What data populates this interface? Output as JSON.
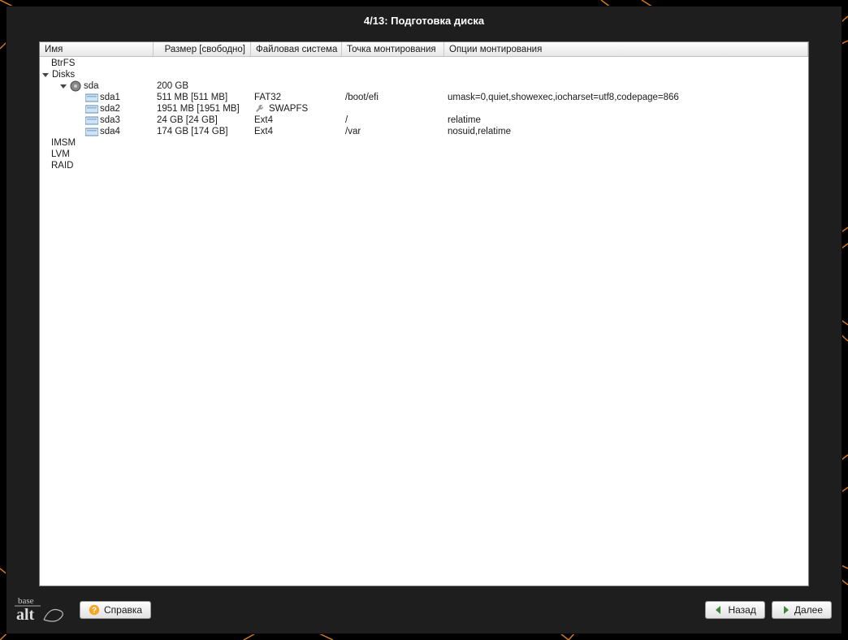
{
  "title": "4/13: Подготовка диска",
  "columns": {
    "name": "Имя",
    "size": "Размер [свободно]",
    "fs": "Файловая система",
    "mount": "Точка монтирования",
    "opts": "Опции монтирования"
  },
  "tree": {
    "btrfs": "BtrFS",
    "disks": "Disks",
    "sda": {
      "name": "sda",
      "size": "200 GB"
    },
    "sda1": {
      "name": "sda1",
      "size": "511 MB [511 MB]",
      "fs": "FAT32",
      "mount": "/boot/efi",
      "opts": "umask=0,quiet,showexec,iocharset=utf8,codepage=866"
    },
    "sda2": {
      "name": "sda2",
      "size": "1951 MB [1951 MB]",
      "fs": "SWAPFS",
      "mount": "",
      "opts": ""
    },
    "sda3": {
      "name": "sda3",
      "size": "24 GB [24 GB]",
      "fs": "Ext4",
      "mount": "/",
      "opts": "relatime"
    },
    "sda4": {
      "name": "sda4",
      "size": "174 GB [174 GB]",
      "fs": "Ext4",
      "mount": "/var",
      "opts": "nosuid,relatime"
    },
    "imsm": "IMSM",
    "lvm": "LVM",
    "raid": "RAID"
  },
  "buttons": {
    "help": "Справка",
    "back": "Назад",
    "next": "Далее"
  },
  "logo": {
    "line1": "base",
    "line2": "alt"
  }
}
